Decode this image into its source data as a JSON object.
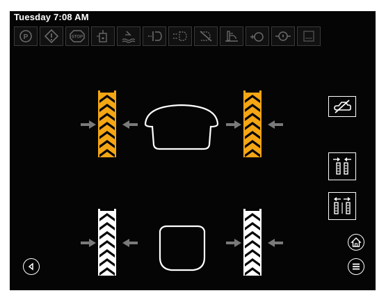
{
  "header": {
    "clock": "Tuesday 7:08 AM"
  },
  "colors": {
    "background": "#050505",
    "front_tyre": "#f4a614",
    "rear_tyre": "#ffffff",
    "status_icon": "#6a6a6a",
    "arrow": "#7a7a7a",
    "outline": "#ffffff"
  },
  "status_icons": [
    "parking-brake-icon",
    "warning-icon",
    "stop-icon",
    "hydraulic-oil-icon",
    "coolant-level-icon",
    "transmission-icon",
    "transmission-alt-icon",
    "transmission-fault-icon",
    "fuel-icon",
    "engine-icon",
    "oil-pressure-icon",
    "display-icon"
  ],
  "axles": {
    "front": {
      "state": "adjusting"
    },
    "rear": {
      "state": "idle"
    }
  }
}
